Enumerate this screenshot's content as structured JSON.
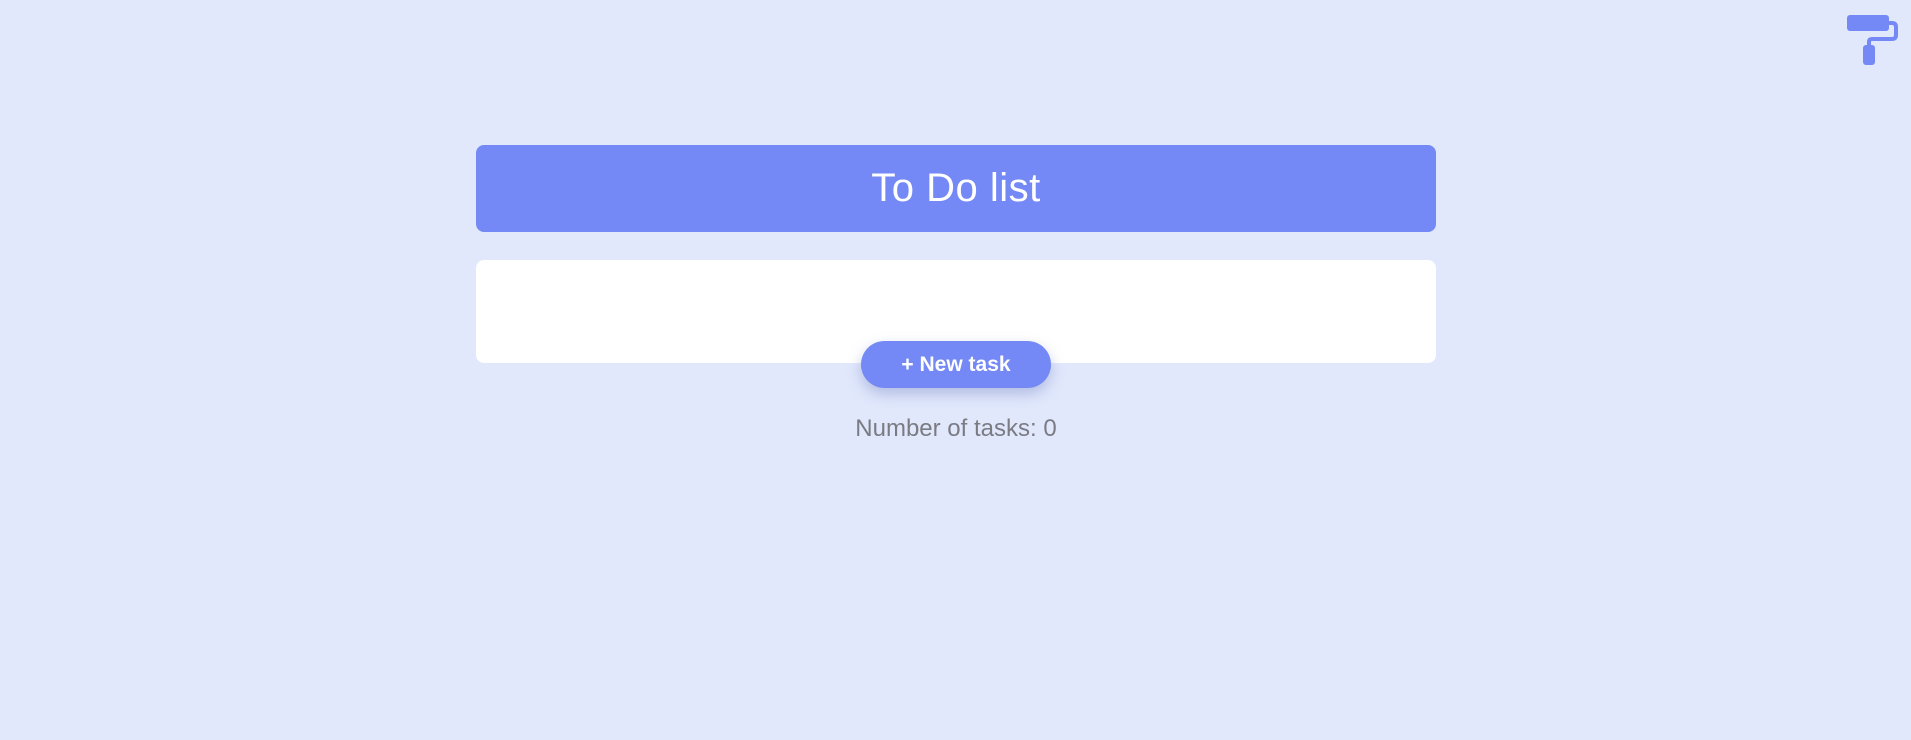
{
  "theme_toggle": {
    "icon": "paint-roller-icon",
    "color": "#7489f5"
  },
  "header": {
    "title": "To Do list"
  },
  "tasks": {
    "items": [],
    "new_task_label": "+ New task"
  },
  "footer": {
    "count_text": "Number of tasks: 0"
  },
  "colors": {
    "background": "#e1e8fc",
    "accent": "#7489f5",
    "panel": "#ffffff",
    "muted_text": "#7b7b84"
  }
}
